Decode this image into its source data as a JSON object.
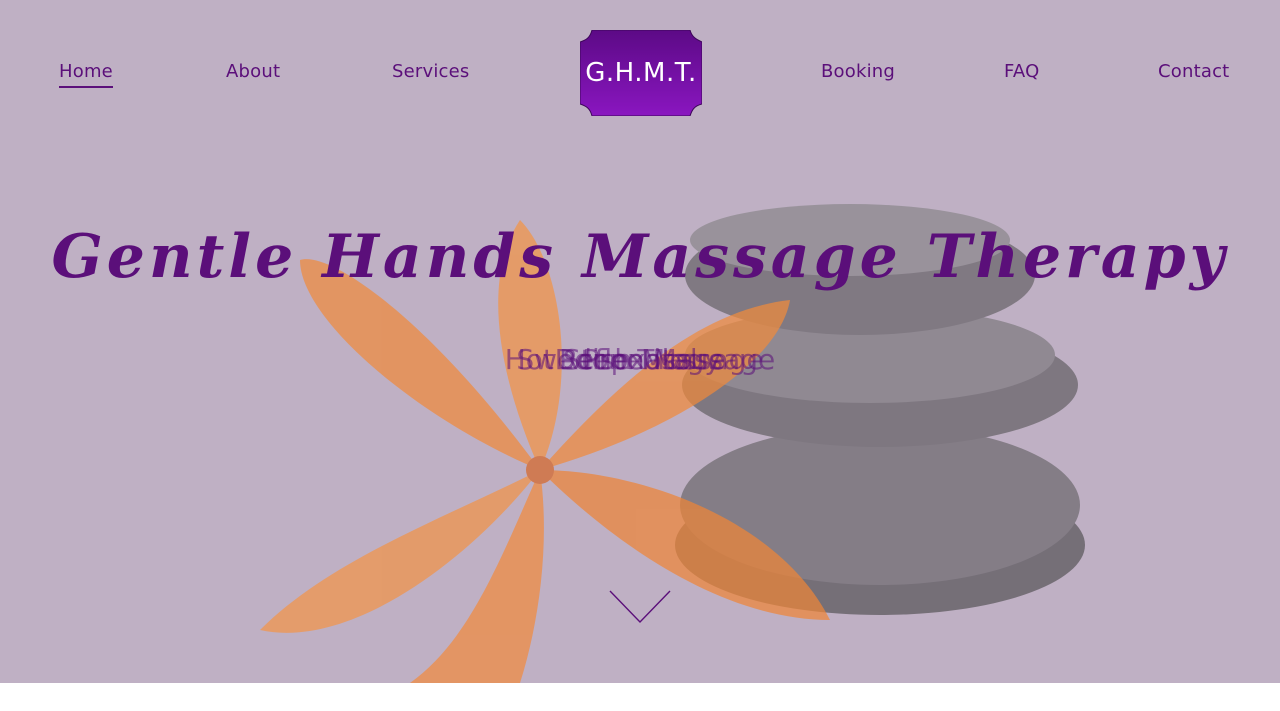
{
  "nav": {
    "items": [
      {
        "label": "Home",
        "active": true
      },
      {
        "label": "About"
      },
      {
        "label": "Services"
      },
      {
        "label": "Booking"
      },
      {
        "label": "FAQ"
      },
      {
        "label": "Contact"
      }
    ]
  },
  "logo": {
    "text": "G.H.M.T."
  },
  "hero": {
    "title": "Gentle Hands Massage Therapy",
    "taglines": [
      "Deep Tissue",
      "Swedish Massage",
      "Hot Stone Massage",
      "Prenatal",
      "Reflexology"
    ],
    "scroll_icon": "chevron-down-icon",
    "background_icons": [
      "lily-flower-image",
      "hot-stones-image"
    ]
  },
  "colors": {
    "accent": "#5b0f7a",
    "background": "#bfb0c4",
    "logo_fill": "#7a10a8"
  }
}
